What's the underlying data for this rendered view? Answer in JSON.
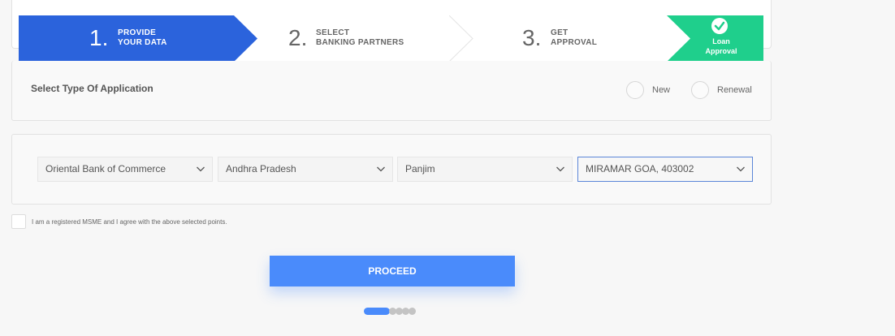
{
  "stepper": {
    "step1": {
      "number": "1.",
      "line1": "PROVIDE",
      "line2": "YOUR DATA"
    },
    "step2": {
      "number": "2.",
      "line1": "SELECT",
      "line2": "BANKING PARTNERS"
    },
    "step3": {
      "number": "3.",
      "line1": "GET",
      "line2": "APPROVAL"
    },
    "step4": {
      "line1": "Loan",
      "line2": "Approval",
      "icon": "check-circle-icon"
    },
    "colors": {
      "active": "#2b63dc",
      "complete": "#1fcf8c"
    }
  },
  "application_type": {
    "title": "Select Type Of Application",
    "options": [
      "New",
      "Renewal"
    ]
  },
  "selects": {
    "bank": "Oriental Bank of Commerce",
    "state": "Andhra Pradesh",
    "city": "Panjim",
    "branch": "MIRAMAR GOA, 403002"
  },
  "agreement": {
    "text": "I am a registered MSME and I agree with the above selected points."
  },
  "proceed": {
    "label": "PROCEED",
    "color": "#4a8bfb"
  },
  "pagination": {
    "total": 5,
    "active": 1
  }
}
